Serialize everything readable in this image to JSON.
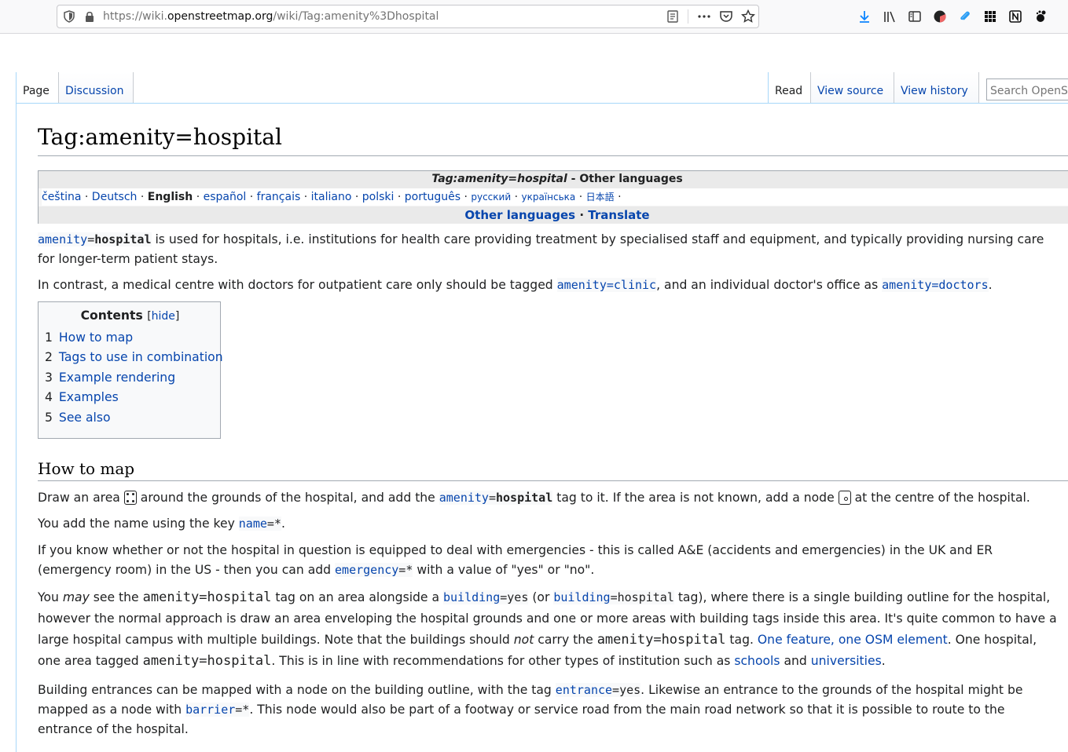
{
  "browser": {
    "url_prefix": "https://wiki.",
    "url_domain": "openstreetmap.org",
    "url_path": "/wiki/Tag:amenity%3Dhospital",
    "icons": [
      "shield-icon",
      "lock-icon",
      "reader-view-icon",
      "more-icon",
      "pocket-icon",
      "bookmark-star-icon",
      "download-icon",
      "library-icon",
      "sidebar-icon",
      "extension-icon",
      "clip-icon",
      "grid-icon",
      "notion-icon",
      "gnome-icon"
    ]
  },
  "tabs": {
    "page": "Page",
    "discussion": "Discussion",
    "read": "Read",
    "view_source": "View source",
    "view_history": "View history",
    "search_placeholder": "Search OpenStreetMap Wiki"
  },
  "title": "Tag:amenity=hospital",
  "langbox": {
    "title_italic": "Tag:amenity=hospital",
    "title_rest": " - Other languages",
    "languages": [
      "čeština",
      "Deutsch",
      "English",
      "español",
      "français",
      "italiano",
      "polski",
      "português",
      "русский",
      "українська",
      "日本語"
    ],
    "other_languages": "Other languages",
    "translate": "Translate"
  },
  "intro": {
    "key": "amenity",
    "eq": "=",
    "value": "hospital",
    "text1": " is used for hospitals, i.e. institutions for health care providing treatment by specialised staff and equipment, and typically providing nursing care for longer-term patient stays.",
    "p2_a": "In contrast, a medical centre with doctors for outpatient care only should be tagged ",
    "p2_clinic_key": "amenity",
    "p2_clinic_val": "=clinic",
    "p2_b": ", and an individual doctor's office as ",
    "p2_doc_key": "amenity",
    "p2_doc_val": "=doctors",
    "p2_c": "."
  },
  "toc": {
    "title": "Contents",
    "hide": "hide",
    "items": [
      {
        "num": "1",
        "label": "How to map"
      },
      {
        "num": "2",
        "label": "Tags to use in combination"
      },
      {
        "num": "3",
        "label": "Example rendering"
      },
      {
        "num": "4",
        "label": "Examples"
      },
      {
        "num": "5",
        "label": "See also"
      }
    ]
  },
  "section1": {
    "heading": "How to map",
    "p1_a": "Draw an area ",
    "p1_b": " around the grounds of the hospital, and add the ",
    "p1_key": "amenity",
    "p1_val": "hospital",
    "p1_c": " tag to it. If the area is not known, add a node ",
    "p1_d": " at the centre of the hospital.",
    "p2_a": "You add the name using the key ",
    "p2_key": "name",
    "p2_val": "=*",
    "p2_b": ".",
    "p3_a": "If you know whether or not the hospital in question is equipped to deal with emergencies - this is called A&E (accidents and emergencies) in the UK and ER (emergency room) in the US - then you can add ",
    "p3_key": "emergency",
    "p3_val": "=*",
    "p3_b": " with a value of \"yes\" or \"no\".",
    "p4_a": "You ",
    "p4_may": "may",
    "p4_b": " see the ",
    "p4_tag": "amenity=hospital",
    "p4_c": " tag on an area alongside a ",
    "p4_bkey": "building",
    "p4_bval": "=yes",
    "p4_d": " (or ",
    "p4_b2key": "building",
    "p4_b2val": "=hospital",
    "p4_e": " tag), where there is a single building outline for the hospital, however the normal approach is draw an area enveloping the hospital grounds and one or more areas with building tags inside this area. It's quite common to have a large hospital campus with multiple buildings. Note that the buildings should ",
    "p4_not": "not",
    "p4_f": " carry the ",
    "p4_tag2": "amenity=hospital",
    "p4_g": " tag. ",
    "p4_link": "One feature, one OSM element",
    "p4_h": ". One hospital, one area tagged ",
    "p4_tag3": "amenity=hospital",
    "p4_i": ". This is in line with recommendations for other types of institution such as ",
    "p4_schools": "schools",
    "p4_j": " and ",
    "p4_univ": "universities",
    "p4_k": ".",
    "p5_a": "Building entrances can be mapped with a node on the building outline, with the tag ",
    "p5_key": "entrance",
    "p5_val": "=yes",
    "p5_b": ". Likewise an entrance to the grounds of the hospital might be mapped as a node with ",
    "p5_bkey": "barrier",
    "p5_bval": "=*",
    "p5_c": ". This node would also be part of a footway or service road from the main road network so that it is possible to route to the entrance of the hospital."
  }
}
